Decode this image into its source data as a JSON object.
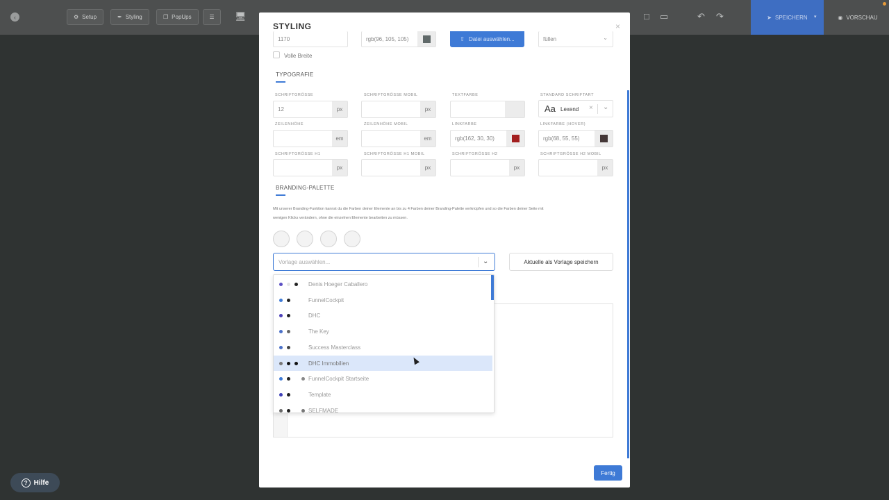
{
  "toolbar": {
    "setup": "Setup",
    "styling": "Styling",
    "popups": "PopUps",
    "save": "SPEICHERN",
    "preview": "VORSCHAU"
  },
  "modal": {
    "title": "STYLING",
    "close": "×",
    "top_row": {
      "width_value": "1170",
      "bg_color_value": "rgb(96, 105, 105)",
      "file_button": "Datei auswählen...",
      "fill_value": "füllen"
    },
    "full_width_label": "Volle Breite",
    "typography_title": "TYPOGRAFIE",
    "labels": {
      "font_size": "SCHRIFTGRÖSSE",
      "font_size_mobile": "SCHRIFTGRÖSSE MOBIL",
      "text_color": "TEXTFARBE",
      "default_font": "STANDARD SCHRIFTART",
      "line_height": "ZEILENHÖHE",
      "line_height_mobile": "ZEILENHÖHE MOBIL",
      "link_color": "LINKFARBE",
      "link_color_hover": "LINKFARBE (HOVER)",
      "h1_size": "SCHRIFTGRÖSSE H1",
      "h1_size_mobile": "SCHRIFTGRÖSSE H1 MOBIL",
      "h2_size": "SCHRIFTGRÖSSE H2",
      "h2_size_mobile": "SCHRIFTGRÖSSE H2 MOBIL"
    },
    "values": {
      "font_size": "12",
      "link_color": "rgb(162, 30, 30)",
      "link_color_hover": "rgb(68, 55, 55)",
      "font_name": "Lexend",
      "font_preview": "Aa"
    },
    "units": {
      "px": "px",
      "em": "em"
    },
    "branding_title": "BRANDING-PALETTE",
    "branding_desc_1": "Mit unserer Branding-Funktion kannst du die Farben deiner Elemente an bis zu 4 Farben deiner Branding-Palette verknüpfen und so die Farben deiner Seite mit",
    "branding_desc_2": "wenigen Klicks verändern, ohne die einzelnen Elemente bearbeiten zu müssen.",
    "template_placeholder": "Vorlage auswählen...",
    "save_template": "Aktuelle als Vorlage speichern",
    "done": "Fertig",
    "colors": {
      "link": "#a21e1e",
      "link_hover": "#443737",
      "accent": "#3e7ad6"
    }
  },
  "templates": [
    {
      "name": "Denis Hoeger Caballero",
      "dots": [
        "#5b4fc4",
        "#e5e5e5",
        "#222222"
      ]
    },
    {
      "name": "FunnelCockpit",
      "dots": [
        "#3e7ad6",
        "#222222"
      ]
    },
    {
      "name": "DHC",
      "dots": [
        "#4b3fb8",
        "#222222"
      ]
    },
    {
      "name": "The Key",
      "dots": [
        "#4a6fc7",
        "#666666"
      ]
    },
    {
      "name": "Success Masterclass",
      "dots": [
        "#4a6fc7",
        "#444444"
      ]
    },
    {
      "name": "DHC Immobilien",
      "dots": [
        "#777777",
        "#111111",
        "#111111"
      ]
    },
    {
      "name": "FunnelCockpit Startseite",
      "dots": [
        "#3e7ad6",
        "#222222",
        "#888888"
      ]
    },
    {
      "name": "Template",
      "dots": [
        "#3e3fb8",
        "#222222"
      ]
    },
    {
      "name": "SELFMADE",
      "dots": [
        "#666666",
        "#222222",
        "#777777"
      ]
    }
  ],
  "help": "Hilfe"
}
